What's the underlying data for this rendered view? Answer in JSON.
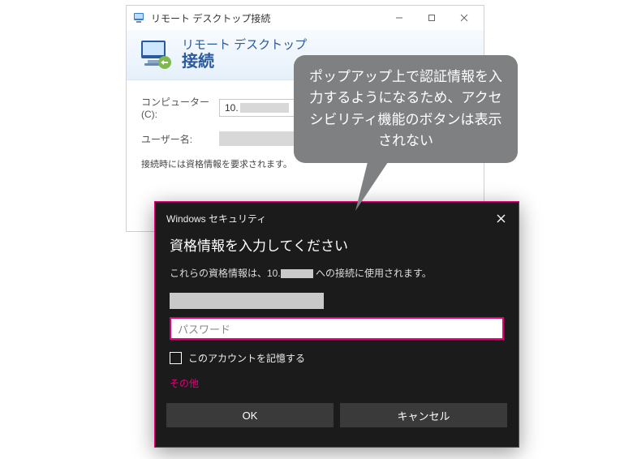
{
  "rdc": {
    "window_title": "リモート デスクトップ接続",
    "header_line1": "リモート デスクトップ",
    "header_line2": "接続",
    "computer_label": "コンピューター(C):",
    "computer_value_prefix": "10.",
    "user_label": "ユーザー名:",
    "credentials_note": "接続時には資格情報を要求されます。"
  },
  "security": {
    "titlebar": "Windows セキュリティ",
    "heading": "資格情報を入力してください",
    "message_prefix": "これらの資格情報は、10.",
    "message_suffix": "への接続に使用されます。",
    "password_placeholder": "パスワード",
    "remember_label": "このアカウントを記憶する",
    "other_label": "その他",
    "ok_label": "OK",
    "cancel_label": "キャンセル"
  },
  "callout": {
    "text": "ポップアップ上で認証情報を入力するようになるため、アクセシビリティ機能のボタンは表示されない"
  }
}
